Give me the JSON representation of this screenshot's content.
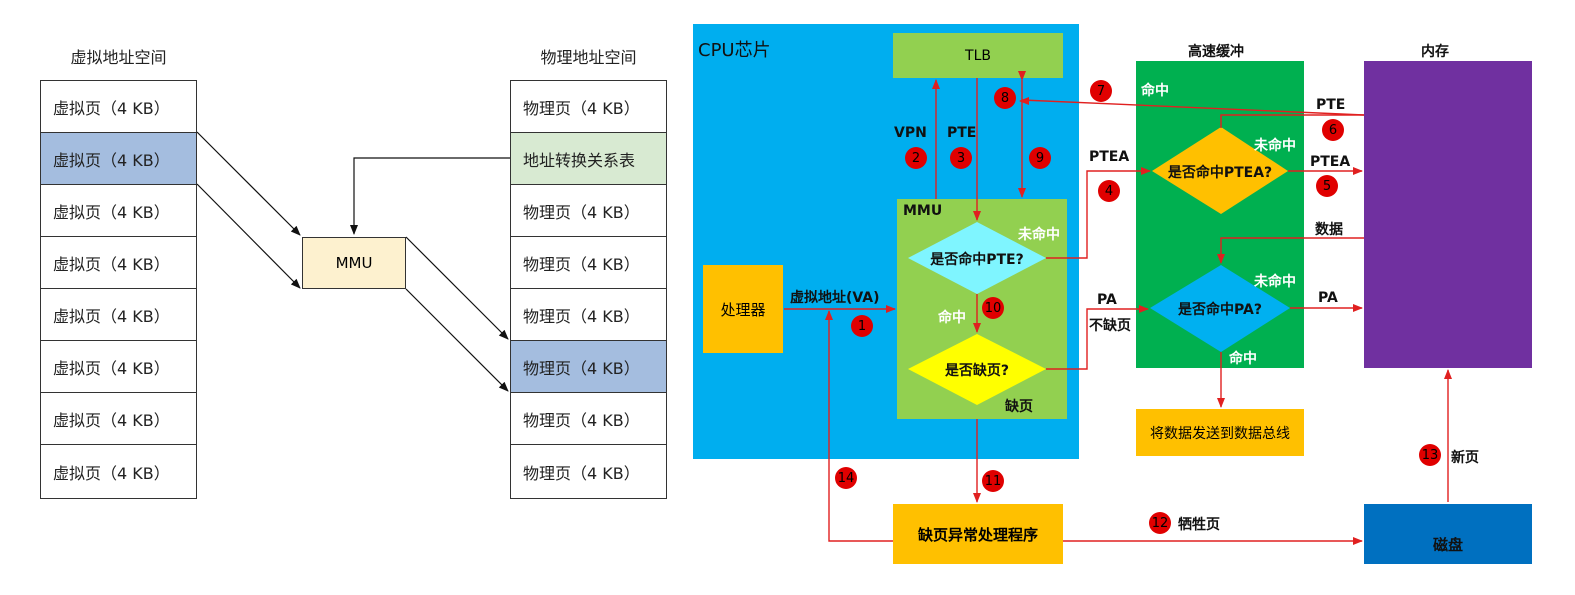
{
  "left": {
    "virtual_title": "虚拟地址空间",
    "physical_title": "物理地址空间",
    "virtual_pages": [
      "虚拟页（4 KB）",
      "虚拟页（4 KB）",
      "虚拟页（4 KB）",
      "虚拟页（4 KB）",
      "虚拟页（4 KB）",
      "虚拟页（4 KB）",
      "虚拟页（4 KB）",
      "虚拟页（4 KB）"
    ],
    "physical_pages": [
      "物理页（4 KB）",
      "地址转换关系表",
      "物理页（4 KB）",
      "物理页（4 KB）",
      "物理页（4 KB）",
      "物理页（4 KB）",
      "物理页（4 KB）",
      "物理页（4 KB）"
    ],
    "mmu": "MMU"
  },
  "cpu": {
    "title": "CPU芯片",
    "tlb": "TLB",
    "mmu": "MMU",
    "processor": "处理器",
    "diamond_pte": "是否命中PTE?",
    "diamond_fault": "是否缺页?",
    "vpn": "VPN",
    "pte": "PTE",
    "va": "虚拟地址(VA)",
    "hit": "命中",
    "miss": "未命中",
    "fault": "缺页"
  },
  "cache": {
    "title": "高速缓冲",
    "diamond_ptea": "是否命中PTEA?",
    "diamond_pa": "是否命中PA?",
    "hit_top": "命中",
    "miss1": "未命中",
    "miss2": "未命中",
    "hit_bottom": "命中",
    "send": "将数据发送到数据总线"
  },
  "memory": {
    "title": "内存"
  },
  "disk": {
    "label": "磁盘"
  },
  "handler": {
    "label": "缺页异常处理程序"
  },
  "arrow_labels": {
    "ptea_left": "PTEA",
    "pa": "PA",
    "no_fault": "不缺页",
    "pte_right": "PTE",
    "ptea_right": "PTEA",
    "data": "数据",
    "pa_right": "PA",
    "victim": "牺牲页",
    "new_page": "新页"
  },
  "badges": [
    "1",
    "2",
    "3",
    "4",
    "5",
    "6",
    "7",
    "8",
    "9",
    "10",
    "11",
    "12",
    "13",
    "14"
  ],
  "colors": {
    "cpu_blue": "#00aeef",
    "tlb_green": "#92d050",
    "mmu_green": "#92d050",
    "diamond_cyan": "#7ff5ff",
    "diamond_yellow": "#ffff00",
    "processor_orange": "#ffc000",
    "cache_green": "#00b050",
    "ptea_diamond": "#ffc000",
    "pa_diamond": "#00b0f0",
    "memory_purple": "#7030a0",
    "disk_blue": "#0070c0",
    "arrow_red": "#e02020",
    "mmu_left_fill": "#fdf1cf"
  }
}
